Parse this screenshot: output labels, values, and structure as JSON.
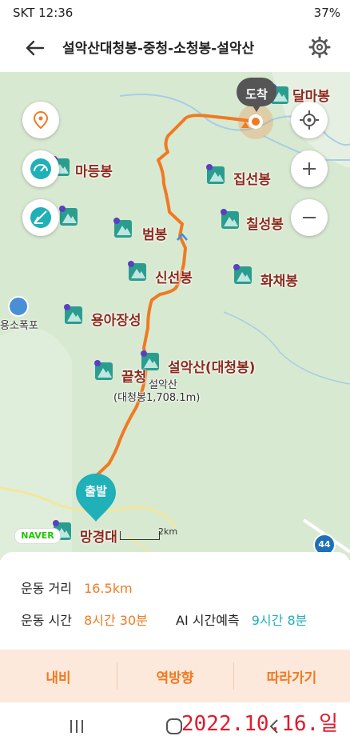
{
  "status": {
    "left": "SKT  12:36",
    "right": "37%"
  },
  "header": {
    "title": "설악산대청봉-중청-소청봉-설악산"
  },
  "map": {
    "peaks": [
      {
        "name": "달마봉"
      },
      {
        "name": "마등봉"
      },
      {
        "name": "집선봉"
      },
      {
        "name": "범봉"
      },
      {
        "name": "칠성봉"
      },
      {
        "name": "신선봉"
      },
      {
        "name": "화채봉"
      },
      {
        "name": "용아장성"
      },
      {
        "name": "설악산(대청봉)"
      },
      {
        "name": "끝청"
      },
      {
        "name": "망경대"
      }
    ],
    "poi": {
      "waterfall": "용소폭포",
      "summit_name": "설악산",
      "summit_detail": "(대청봉1,708.1m)"
    },
    "start_label": "출발",
    "end_label": "도착",
    "scale_label": "2km",
    "naver": "NAVER",
    "road_no": "44"
  },
  "stats": {
    "distance_label": "운동 거리",
    "distance_value": "16.5km",
    "time_label": "운동 시간",
    "time_value": "8시간 30분",
    "ai_label": "AI 시간예측",
    "ai_value": "9시간 8분"
  },
  "actions": {
    "navi": "내비",
    "reverse": "역방향",
    "follow": "따라가기"
  },
  "photo_date": "2022.10.16.일",
  "colors": {
    "route": "#f07a22",
    "accent_teal": "#1fb0b8",
    "peak_icon": "#2a9d8f"
  }
}
